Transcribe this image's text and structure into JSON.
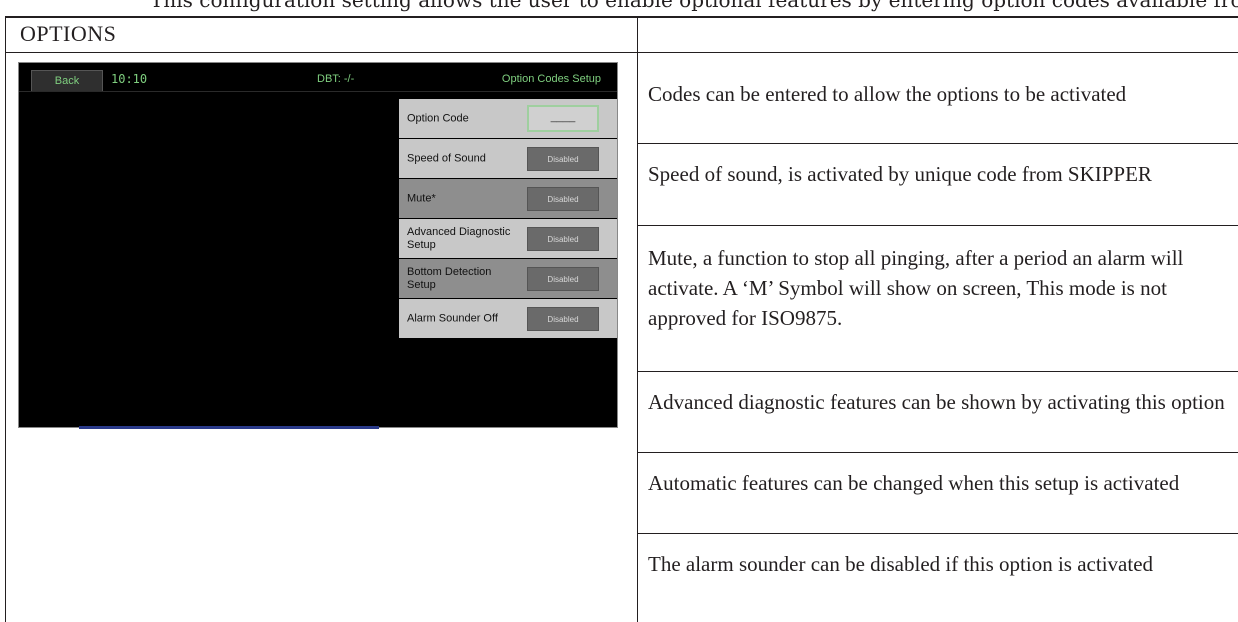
{
  "header_cutoff_text": "This configuration setting allows the user to enable optional features by entering option codes available from SKIPPER.",
  "section_title": "OPTIONS",
  "screen": {
    "back_label": "Back",
    "clock": "10:10",
    "dbt": "DBT: -/-",
    "title": "Option Codes Setup",
    "rows": [
      {
        "label": "Option Code",
        "value": "____",
        "kind": "input"
      },
      {
        "label": "Speed of Sound",
        "value": "Disabled",
        "kind": "status"
      },
      {
        "label": "Mute*",
        "value": "Disabled",
        "kind": "status"
      },
      {
        "label": "Advanced Diagnostic Setup",
        "value": "Disabled",
        "kind": "status"
      },
      {
        "label": "Bottom Detection Setup",
        "value": "Disabled",
        "kind": "status"
      },
      {
        "label": "Alarm Sounder Off",
        "value": "Disabled",
        "kind": "status"
      }
    ]
  },
  "descriptions": [
    "Codes can be entered to allow the options to be activated",
    "Speed of sound, is activated by unique code from SKIPPER",
    "Mute, a function to stop all pinging, after a period an alarm will activate. A ‘M’ Symbol will show on screen, This mode is not approved for ISO9875.",
    "Advanced diagnostic features can be shown by activating this option",
    "Automatic features can be changed when this setup is activated",
    "The alarm sounder can be disabled if this option is activated"
  ]
}
